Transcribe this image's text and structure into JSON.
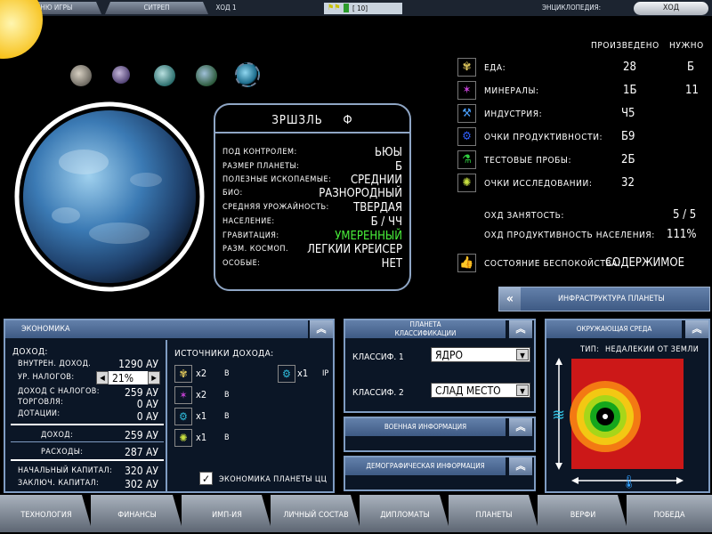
{
  "topbar": {
    "game_menu": "МЕНЮ ИГРЫ",
    "planet_name": "СИТРЕП",
    "turn": "ХОД 1",
    "stats": "[  10]",
    "encyclopedia": "ЭНЦИКЛОПЕДИЯ:",
    "end_turn": "ХОД"
  },
  "planet": {
    "name": "ЗРШЗЛЬ",
    "class_symbol": "Ф",
    "rows": [
      {
        "k": "ПОД КОНТРОЛЕМ:",
        "v": "ЬЮЫ",
        "color": "#ffffff"
      },
      {
        "k": "РАЗМЕР ПЛАНЕТЫ:",
        "v": "Б",
        "color": "#ffffff"
      },
      {
        "k": "ПОЛЕЗНЫЕ ИСКОПАЕМЫЕ:",
        "v": "СРЕДНИИ",
        "color": "#ffffff"
      },
      {
        "k": "БИО:",
        "v": "РАЗНОРОДНЫЙ",
        "color": "#ffffff"
      },
      {
        "k": "СРЕДНЯЯ УРОЖАЙНОСТЬ:",
        "v": "ТВЕРДАЯ",
        "color": "#ffffff"
      },
      {
        "k": "НАСЕЛЕНИЕ:",
        "v": "Б / ЧЧ",
        "color": "#ffffff"
      },
      {
        "k": "ГРАВИТАЦИЯ:",
        "v": "УМЕРЕННЫЙ",
        "color": "#49f03a"
      },
      {
        "k": "РАЗМ. КОСМОП.",
        "v": "ЛЕГКИИ КРЕИСЕР",
        "color": "#ffffff"
      },
      {
        "k": "ОСОБЫЕ:",
        "v": "НЕТ",
        "color": "#ffffff"
      }
    ]
  },
  "production": {
    "col_produced": "ПРОИЗВЕДЕНО",
    "col_needed": "НУЖНО",
    "rows": [
      {
        "label": "ЕДА:",
        "produced": "28",
        "needed": "Б",
        "icon": "wheat-icon",
        "color": "#d9c25a",
        "glyph": "✾"
      },
      {
        "label": "МИНЕРАЛЫ:",
        "produced": "1Б",
        "needed": "11",
        "icon": "crystal-icon",
        "color": "#c040d0",
        "glyph": "✶"
      },
      {
        "label": "ИНДУСТРИЯ:",
        "produced": "Ч5",
        "needed": "",
        "icon": "hammer-icon",
        "color": "#4aa0ff",
        "glyph": "⚒"
      },
      {
        "label": "ОЧКИ ПРОДУКТИВНОСТИ:",
        "produced": "Б9",
        "needed": "",
        "icon": "gear-icon",
        "color": "#3060ff",
        "glyph": "⚙"
      },
      {
        "label": "ТЕСТОВЫЕ ПРОБЫ:",
        "produced": "2Б",
        "needed": "",
        "icon": "flask-icon",
        "color": "#30d040",
        "glyph": "⚗"
      },
      {
        "label": "ОЧКИ ИССЛЕДОВАНИИ:",
        "produced": "32",
        "needed": "",
        "icon": "bulb-icon",
        "color": "#c8e040",
        "glyph": "✺"
      }
    ],
    "jobs_label": "ОХД ЗАНЯТОСТЬ:",
    "jobs_value": "5 / 5",
    "prod_label": "ОХД ПРОДУКТИВНОСТЬ НАСЕЛЕНИЯ:",
    "prod_value": "111%",
    "unrest_label": "СОСТОЯНИЕ БЕСПОКОЙСТВА:",
    "unrest_value": "СОДЕРЖИМОЕ"
  },
  "infra_button": "ИНФРАСТРУКТУРА ПЛАНЕТЫ",
  "economy": {
    "title": "ЭКОНОМИКА",
    "income_label": "ДОХОД:",
    "rows": [
      {
        "k": "ВНУТРЕН. ДОХОД.",
        "v": "1290 АУ"
      },
      {
        "k": "УР. НАЛОГОВ:",
        "v": "21%"
      },
      {
        "k": "ДОХОД С НАЛОГОВ:",
        "v": "259 АУ"
      },
      {
        "k": "ТОРГОВЛЯ:",
        "v": "0 АУ"
      },
      {
        "k": "ДОТАЦИИ:",
        "v": "0 АУ"
      }
    ],
    "income_total_label": "ДОХОД:",
    "income_total": "259 АУ",
    "expenses_label": "РАСХОДЫ:",
    "expenses": "287 АУ",
    "start_label": "НАЧАЛЬНЫЙ КАПИТАЛ:",
    "start": "320 АУ",
    "end_label": "ЗАКЛЮЧ. КАПИТАЛ:",
    "end": "302 АУ",
    "sources_title": "ИСТОЧНИКИ ДОХОДА:",
    "sources": [
      {
        "mult": "x2",
        "unit": "В",
        "icon": "wheat-icon",
        "color": "#d9c25a",
        "glyph": "✾"
      },
      {
        "mult": "x2",
        "unit": "В",
        "icon": "crystal-icon",
        "color": "#c040d0",
        "glyph": "✶"
      },
      {
        "mult": "x1",
        "unit": "В",
        "icon": "gear-icon",
        "color": "#30c0e0",
        "glyph": "⚙"
      },
      {
        "mult": "x1",
        "unit": "В",
        "icon": "bulb-icon",
        "color": "#c8e040",
        "glyph": "✺"
      }
    ],
    "source_extra": {
      "mult": "x1",
      "unit": "IP",
      "icon": "gear-icon",
      "color": "#30c0e0",
      "glyph": "⚙"
    },
    "checkbox_label": "ЭКОНОМИКА ПЛАНЕТЫ ЦЦ"
  },
  "classification": {
    "title_line1": "ПЛАНЕТА",
    "title_line2": "КЛАССИФИКАЦИИ",
    "class1_label": "КЛАССИФ. 1",
    "class1_value": "ЯДРО",
    "class2_label": "КЛАССИФ. 2",
    "class2_value": "СЛАД МЕСТО"
  },
  "military": {
    "title": "ВОЕННАЯ ИНФОРМАЦИЯ"
  },
  "demographic": {
    "title": "ДЕМОГРАФИЧЕСКАЯ ИНФОРМАЦИЯ"
  },
  "environment": {
    "title": "ОКРУЖАЮЩАЯ СРЕДА",
    "type_label": "ТИП:",
    "type_value": "НЕДАЛЕКИИ ОТ ЗЕМЛИ"
  },
  "bottom_tabs": [
    "ТЕХНОЛОГИЯ",
    "ФИНАНСЫ",
    "ИМП-ИЯ",
    "ЛИЧНЫЙ СОСТАВ",
    "ДИПЛОМАТЫ",
    "ПЛАНЕТЫ",
    "ВЕРФИ",
    "ПОБЕДА"
  ],
  "colors": {
    "panel_border": "#7f9cc2",
    "panel_head": "#4e6c96",
    "accent_green": "#49f03a"
  }
}
